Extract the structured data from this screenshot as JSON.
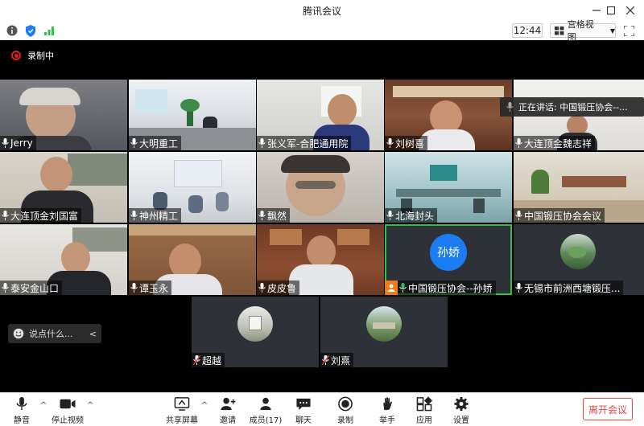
{
  "window": {
    "title": "腾讯会议"
  },
  "toolbar": {
    "time": "12:44",
    "view_label": "宫格视图"
  },
  "recording": {
    "label": "录制中"
  },
  "speaking": {
    "label": "正在讲话: 中国锻压协会--..."
  },
  "chat": {
    "placeholder": "说点什么..."
  },
  "participants": [
    "Jerry",
    "大明重工",
    "张义军-合肥通用院",
    "刘树喜",
    "大连顶金魏志祥",
    "大连顶金刘国富",
    "神州精工",
    "飘然",
    "北海封头",
    "中国锻压协会会议",
    "泰安金山口",
    "谭玉永",
    "皮皮鲁",
    "中国锻压协会--孙娇",
    "无锡市前洲西塘锻压...",
    "超越",
    "刘熹"
  ],
  "avatar_text": "孙娇",
  "bottom": {
    "mute": "静音",
    "stop_video": "停止视频",
    "share": "共享屏幕",
    "invite": "邀请",
    "members": "成员(17)",
    "chat": "聊天",
    "record": "录制",
    "raise_hand": "举手",
    "apps": "应用",
    "settings": "设置",
    "leave": "离开会议"
  },
  "colors": {
    "accent": "#1a7ef2",
    "record": "#e02020",
    "leave": "#e64545",
    "active": "#2fc04b"
  }
}
